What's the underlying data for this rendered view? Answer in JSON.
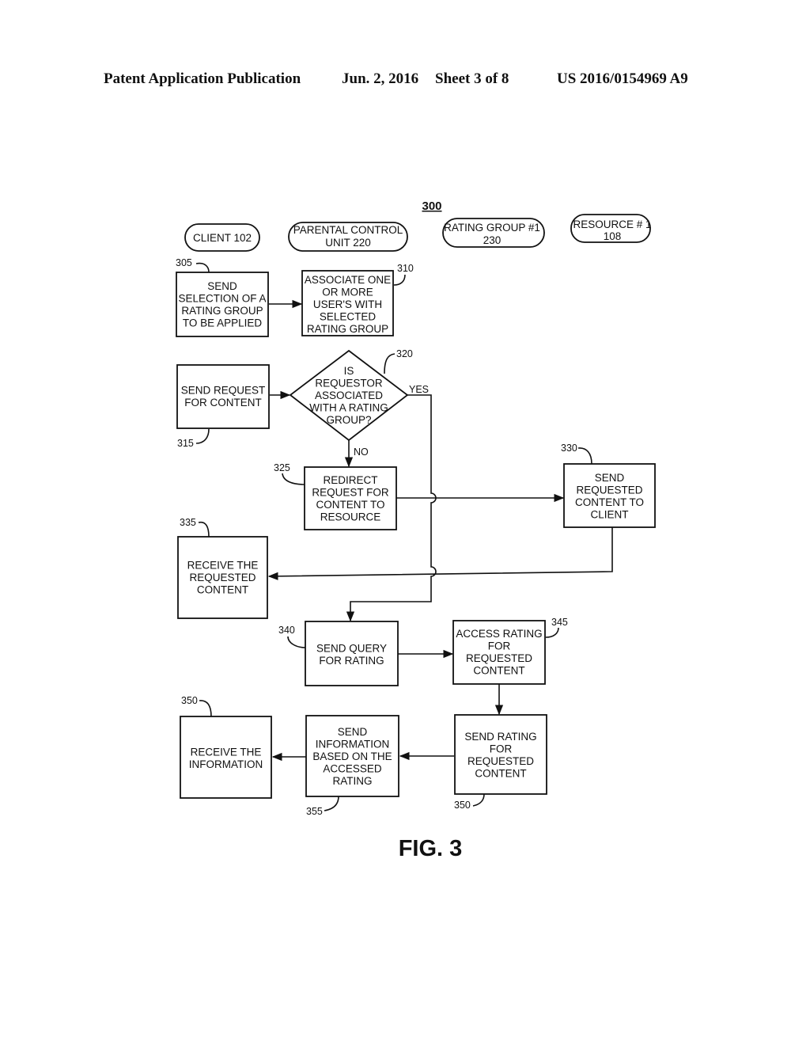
{
  "header": {
    "publication": "Patent Application Publication",
    "date": "Jun. 2, 2016",
    "sheet": "Sheet 3 of 8",
    "patent_number": "US 2016/0154969 A9"
  },
  "figure": {
    "number": "300",
    "caption": "FIG. 3"
  },
  "lanes": [
    {
      "lines": [
        "CLIENT 102"
      ]
    },
    {
      "lines": [
        "PARENTAL CONTROL",
        "UNIT 220"
      ]
    },
    {
      "lines": [
        "RATING GROUP #1",
        "230"
      ]
    },
    {
      "lines": [
        "RESOURCE # 1",
        "108"
      ]
    }
  ],
  "steps": {
    "s305": {
      "ref": "305",
      "lines": [
        "SEND",
        "SELECTION OF A",
        "RATING GROUP",
        "TO BE APPLIED"
      ]
    },
    "s310": {
      "ref": "310",
      "lines": [
        "ASSOCIATE ONE",
        "OR MORE",
        "USER'S WITH",
        "SELECTED",
        "RATING GROUP"
      ]
    },
    "s315": {
      "ref": "315",
      "lines": [
        "SEND REQUEST",
        "FOR CONTENT"
      ]
    },
    "s320": {
      "ref": "320",
      "lines": [
        "IS",
        "REQUESTOR",
        "ASSOCIATED",
        "WITH A RATING",
        "GROUP?"
      ],
      "yes": "YES",
      "no": "NO"
    },
    "s325": {
      "ref": "325",
      "lines": [
        "REDIRECT",
        "REQUEST FOR",
        "CONTENT TO",
        "RESOURCE"
      ]
    },
    "s330": {
      "ref": "330",
      "lines": [
        "SEND",
        "REQUESTED",
        "CONTENT TO",
        "CLIENT"
      ]
    },
    "s335": {
      "ref": "335",
      "lines": [
        "RECEIVE THE",
        "REQUESTED",
        "CONTENT"
      ]
    },
    "s340": {
      "ref": "340",
      "lines": [
        "SEND QUERY",
        "FOR RATING"
      ]
    },
    "s345": {
      "ref": "345",
      "lines": [
        "ACCESS RATING",
        "FOR",
        "REQUESTED",
        "CONTENT"
      ]
    },
    "s350a": {
      "ref": "350",
      "lines": [
        "RECEIVE THE",
        "INFORMATION"
      ]
    },
    "s355": {
      "ref": "355",
      "lines": [
        "SEND",
        "INFORMATION",
        "BASED ON THE",
        "ACCESSED",
        "RATING"
      ]
    },
    "s350b": {
      "ref": "350",
      "lines": [
        "SEND RATING",
        "FOR",
        "REQUESTED",
        "CONTENT"
      ]
    }
  }
}
